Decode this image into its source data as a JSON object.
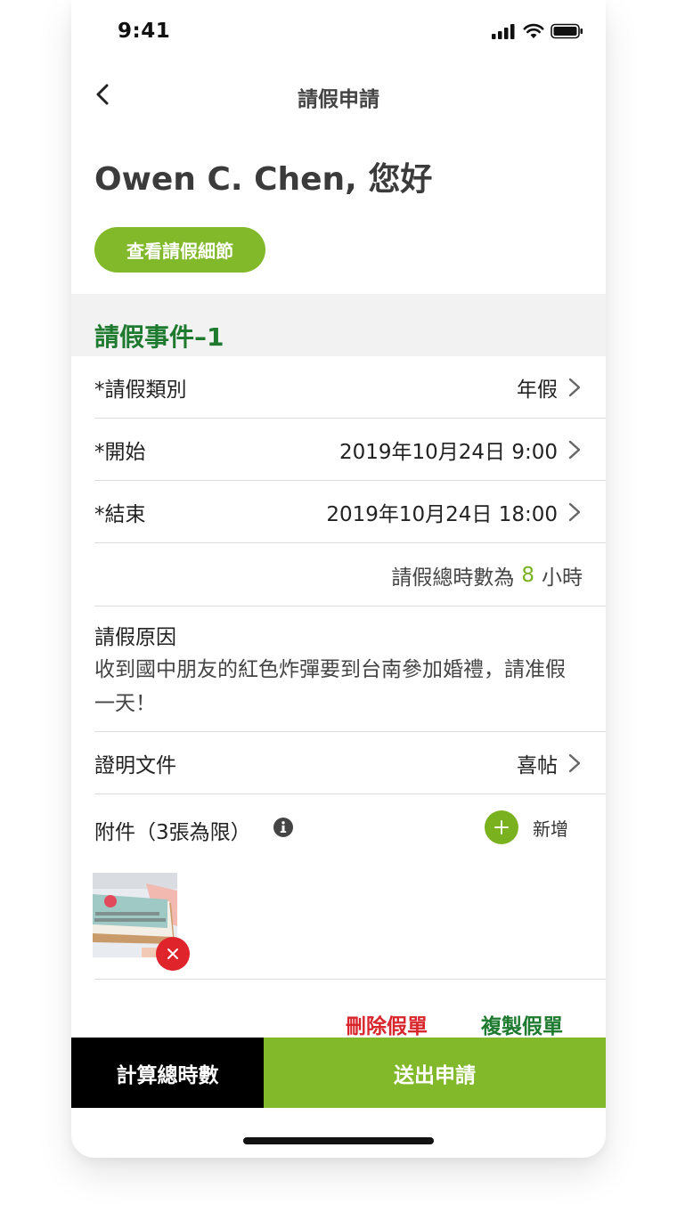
{
  "status_bar": {
    "time": "9:41",
    "icons": [
      "signal-icon",
      "wifi-icon",
      "battery-icon"
    ]
  },
  "nav": {
    "title": "請假申請",
    "back_icon": "chevron-left-icon"
  },
  "greeting": "Owen C. Chen, 您好",
  "view_details_label": "查看請假細節",
  "section_title": "請假事件–1",
  "fields": {
    "leave_type": {
      "label": "*請假類別",
      "value": "年假"
    },
    "start": {
      "label": "*開始",
      "value": "2019年10月24日 9:00"
    },
    "end": {
      "label": "*結束",
      "value": "2019年10月24日 18:00"
    },
    "total": {
      "prefix": "請假總時數為",
      "hours": "8",
      "suffix": "小時"
    },
    "reason": {
      "label": "請假原因",
      "text": "收到國中朋友的紅色炸彈要到台南參加婚禮，請准假一天！"
    },
    "proof": {
      "label": "證明文件",
      "value": "喜帖"
    },
    "attachments": {
      "label": "附件（3張為限）",
      "add_label": "新增"
    }
  },
  "actions": {
    "delete_label": "刪除假單",
    "copy_label": "複製假單"
  },
  "bottom_bar": {
    "calc_label": "計算總時數",
    "submit_label": "送出申請"
  },
  "colors": {
    "accent_green": "#82b92b",
    "title_green": "#1d7a2e",
    "danger_red": "#d8262c"
  }
}
